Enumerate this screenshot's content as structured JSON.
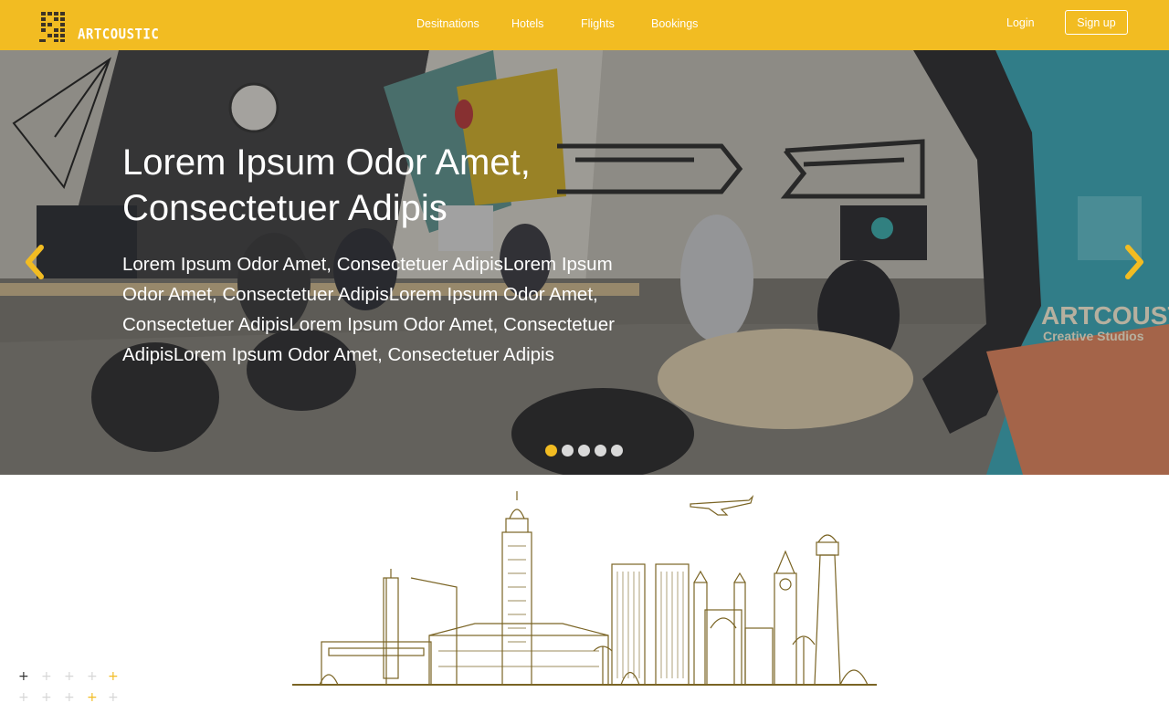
{
  "brand": {
    "name": "ARTCOUSTIC",
    "primary_color": "#f2bc22",
    "logo_icon": "logo-mark-icon"
  },
  "nav": {
    "items": [
      {
        "label": "Desitnations"
      },
      {
        "label": "Hotels"
      },
      {
        "label": "Flights"
      },
      {
        "label": "Bookings"
      }
    ],
    "login_label": "Login",
    "signup_label": "Sign up"
  },
  "hero": {
    "title": "Lorem Ipsum Odor Amet, Consectetuer Adipis",
    "body": "Lorem Ipsum Odor Amet, Consectetuer AdipisLorem Ipsum Odor Amet, Consectetuer AdipisLorem Ipsum Odor Amet, Consectetuer AdipisLorem Ipsum Odor Amet, Consectetuer AdipisLorem Ipsum Odor Amet, Consectetuer Adipis",
    "prev_icon": "chevron-left-icon",
    "next_icon": "chevron-right-icon",
    "slides_total": 5,
    "active_slide": 1,
    "bg_illustration": "office-photo",
    "sign_text": "ARTCOUSTIC",
    "sign_subtext": "Creative Studios"
  },
  "decor": {
    "skyline_icon": "city-skyline-icon",
    "airplane_icon": "airplane-icon",
    "plus_icon": "plus-icon"
  }
}
